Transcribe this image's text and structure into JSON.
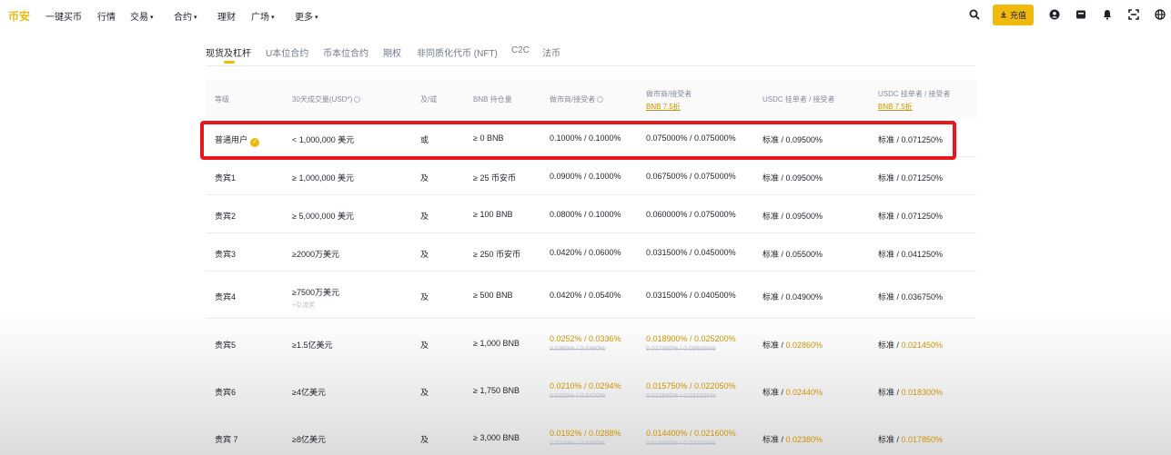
{
  "nav": {
    "logo": "币安",
    "items": [
      {
        "label": "一键买币",
        "caret": ""
      },
      {
        "label": "行情",
        "caret": ""
      },
      {
        "label": "交易",
        "caret": "▾"
      },
      {
        "label": "合约",
        "caret": "▾"
      },
      {
        "label": "理财",
        "caret": ""
      },
      {
        "label": "广场",
        "caret": "▾"
      },
      {
        "label": "更多",
        "caret": "▾"
      }
    ],
    "deposit_label": "充值"
  },
  "tabs": [
    {
      "label": "现货及杠杆"
    },
    {
      "label": "U本位合约"
    },
    {
      "label": "币本位合约"
    },
    {
      "label": "期权"
    },
    {
      "label": "非同质化代币 (NFT)"
    },
    {
      "label": "C2C"
    },
    {
      "label": "法币"
    }
  ],
  "table": {
    "headers": {
      "level": "等级",
      "volume": "30天成交量(USD*)",
      "andor": "及/或",
      "bnb": "BNB 持仓量",
      "maker_taker": "做市商/接受者",
      "maker_taker_bnb": "做市商/接受者",
      "maker_taker_bnb_sub": "BNB 7.5折",
      "usdc": "USDC 挂单者 / 接受者",
      "usdc_bnb": "USDC 挂单者 / 接受者",
      "usdc_bnb_sub": "BNB 7.5折"
    },
    "rows": [
      {
        "level": "普通用户",
        "volume": "< 1,000,000 美元",
        "volume_sub": "",
        "andor": "或",
        "bnb": "≥ 0 BNB",
        "fee": "0.1000% / 0.1000%",
        "fee_old": "",
        "fee_bnb": "0.075000% / 0.075000%",
        "fee_bnb_old": "",
        "usdc_prefix": "标准 / ",
        "usdc_val": "0.09500%",
        "usdc_bnb_prefix": "标准 / ",
        "usdc_bnb_val": "0.071250%"
      },
      {
        "level": "贵宾1",
        "volume": "≥ 1,000,000 美元",
        "volume_sub": "",
        "andor": "及",
        "bnb": "≥ 25 币安币",
        "fee": "0.0900% / 0.1000%",
        "fee_old": "",
        "fee_bnb": "0.067500% / 0.075000%",
        "fee_bnb_old": "",
        "usdc_prefix": "标准 / ",
        "usdc_val": "0.09500%",
        "usdc_bnb_prefix": "标准 / ",
        "usdc_bnb_val": "0.071250%"
      },
      {
        "level": "贵宾2",
        "volume": "≥ 5,000,000 美元",
        "volume_sub": "",
        "andor": "及",
        "bnb": "≥ 100 BNB",
        "fee": "0.0800% / 0.1000%",
        "fee_old": "",
        "fee_bnb": "0.060000% / 0.075000%",
        "fee_bnb_old": "",
        "usdc_prefix": "标准 / ",
        "usdc_val": "0.09500%",
        "usdc_bnb_prefix": "标准 / ",
        "usdc_bnb_val": "0.071250%"
      },
      {
        "level": "贵宾3",
        "volume": "≥2000万美元",
        "volume_sub": "",
        "andor": "及",
        "bnb": "≥ 250 币安币",
        "fee": "0.0420% / 0.0600%",
        "fee_old": "",
        "fee_bnb": "0.031500% / 0.045000%",
        "fee_bnb_old": "",
        "usdc_prefix": "标准 / ",
        "usdc_val": "0.05500%",
        "usdc_bnb_prefix": "标准 / ",
        "usdc_bnb_val": "0.041250%"
      },
      {
        "level": "贵宾4",
        "volume": "≥7500万美元",
        "volume_sub": "+引流奖",
        "andor": "及",
        "bnb": "≥ 500 BNB",
        "fee": "0.0420% / 0.0540%",
        "fee_old": "",
        "fee_bnb": "0.031500% / 0.040500%",
        "fee_bnb_old": "",
        "usdc_prefix": "标准 / ",
        "usdc_val": "0.04900%",
        "usdc_bnb_prefix": "标准 / ",
        "usdc_bnb_val": "0.036750%"
      },
      {
        "level": "贵宾5",
        "volume": "≥1.5亿美元",
        "volume_sub": "",
        "andor": "及",
        "bnb": "≥ 1,000 BNB",
        "fee": "0.0252% / 0.0336%",
        "fee_old": "0.0360% / 0.0480%",
        "fee_bnb": "0.018900% / 0.025200%",
        "fee_bnb_old": "0.027000% / 0.036000%",
        "usdc_prefix": "标准 / ",
        "usdc_val": "0.02860%",
        "usdc_bnb_prefix": "标准 / ",
        "usdc_bnb_val": "0.021450%"
      },
      {
        "level": "贵宾6",
        "volume": "≥4亿美元",
        "volume_sub": "",
        "andor": "及",
        "bnb": "≥ 1,750 BNB",
        "fee": "0.0210% / 0.0294%",
        "fee_old": "0.0300% / 0.0420%",
        "fee_bnb": "0.015750% / 0.022050%",
        "fee_bnb_old": "0.022500% / 0.031500%",
        "usdc_prefix": "标准 / ",
        "usdc_val": "0.02440%",
        "usdc_bnb_prefix": "标准 / ",
        "usdc_bnb_val": "0.018300%"
      },
      {
        "level": "贵宾 7",
        "volume": "≥8亿美元",
        "volume_sub": "",
        "andor": "及",
        "bnb": "≥ 3,000 BNB",
        "fee": "0.0192% / 0.0288%",
        "fee_old": "0.0240% / 0.0360%",
        "fee_bnb": "0.014400% / 0.021600%",
        "fee_bnb_old": "0.018000% / 0.027000%",
        "usdc_prefix": "标准 / ",
        "usdc_val": "0.02380%",
        "usdc_bnb_prefix": "标准 / ",
        "usdc_bnb_val": "0.017850%"
      }
    ]
  },
  "colors": {
    "accent": "#f0b90b",
    "highlight_box": "#e8181a"
  },
  "icons": [
    "search-icon",
    "user-icon",
    "wallet-icon",
    "bell-icon",
    "download-icon",
    "globe-icon"
  ]
}
